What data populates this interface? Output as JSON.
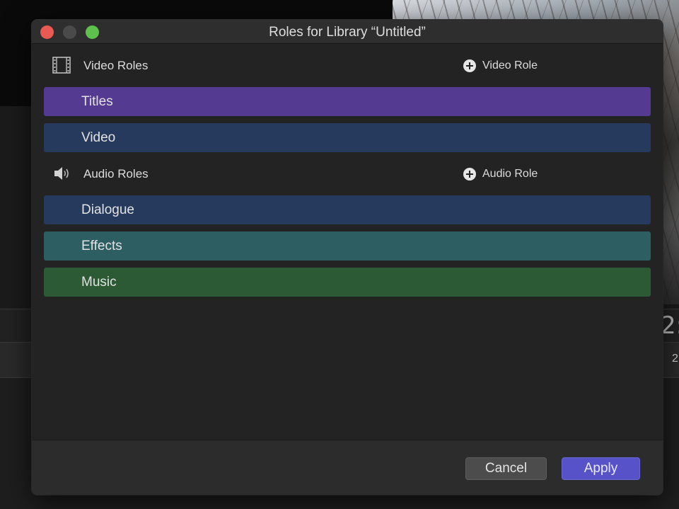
{
  "window": {
    "title": "Roles for Library “Untitled”"
  },
  "background": {
    "timecode_partial": "2:",
    "small_number_partial": "2"
  },
  "video_section": {
    "icon": "film-strip-icon",
    "label": "Video Roles",
    "add_label": "Video Role",
    "roles": [
      {
        "label": "Titles",
        "color": "#553a92"
      },
      {
        "label": "Video",
        "color": "#263a5e"
      }
    ]
  },
  "audio_section": {
    "icon": "speaker-icon",
    "label": "Audio Roles",
    "add_label": "Audio Role",
    "roles": [
      {
        "label": "Dialogue",
        "color": "#263a5e"
      },
      {
        "label": "Effects",
        "color": "#2c5e62"
      },
      {
        "label": "Music",
        "color": "#2b5a34"
      }
    ]
  },
  "footer": {
    "cancel_label": "Cancel",
    "apply_label": "Apply"
  },
  "colors": {
    "accent": "#5852c9",
    "close": "#e95b52",
    "maximize": "#5ec14b"
  }
}
